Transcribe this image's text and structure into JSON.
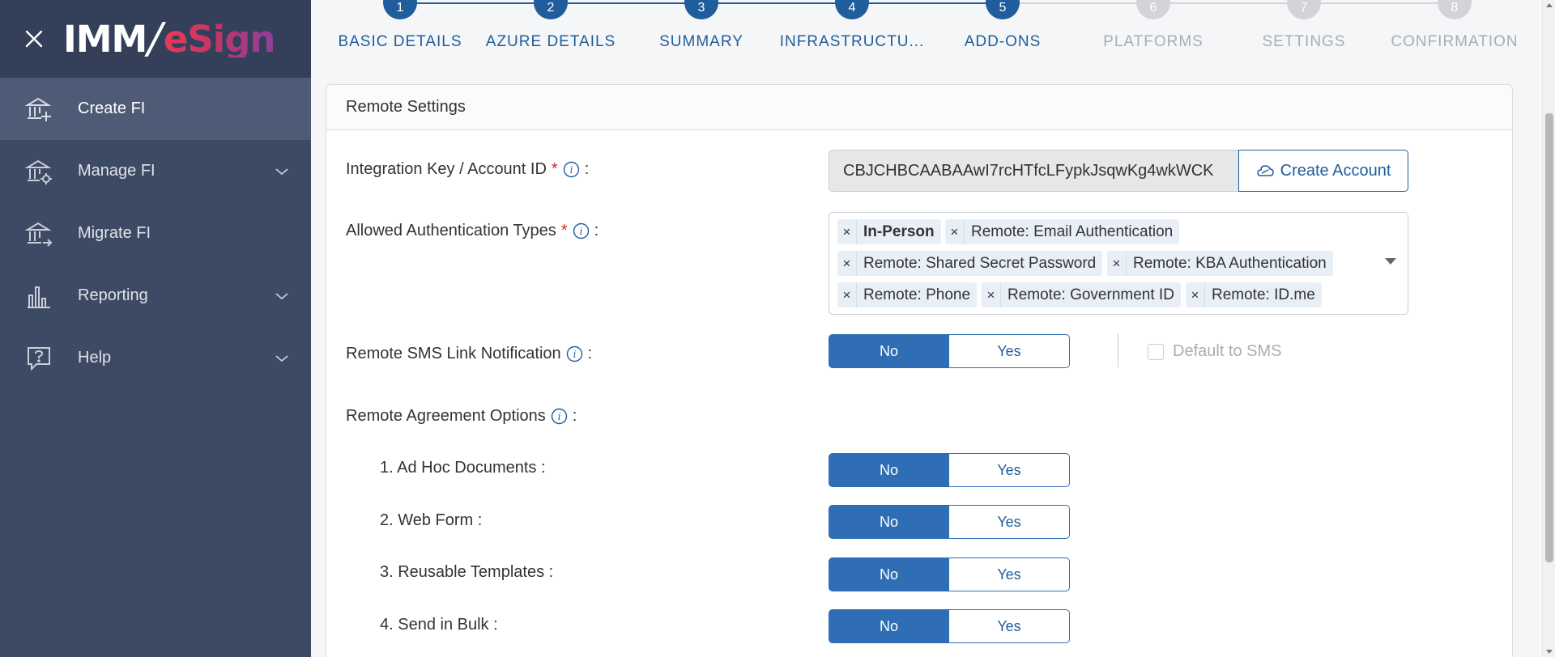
{
  "sidebar": {
    "close_icon": "close-icon",
    "logo": {
      "part1": "IMM",
      "slash": "/",
      "part2": "eSign"
    },
    "items": [
      {
        "label": "Create FI",
        "icon": "bank-add-icon",
        "active": true,
        "has_chevron": false
      },
      {
        "label": "Manage FI",
        "icon": "bank-gear-icon",
        "active": false,
        "has_chevron": true
      },
      {
        "label": "Migrate FI",
        "icon": "bank-arrow-icon",
        "active": false,
        "has_chevron": false
      },
      {
        "label": "Reporting",
        "icon": "bar-chart-icon",
        "active": false,
        "has_chevron": true
      },
      {
        "label": "Help",
        "icon": "help-bubble-icon",
        "active": false,
        "has_chevron": true
      }
    ]
  },
  "stepper": {
    "steps": [
      {
        "number": "1",
        "label": "BASIC DETAILS",
        "done": true
      },
      {
        "number": "2",
        "label": "AZURE DETAILS",
        "done": true
      },
      {
        "number": "3",
        "label": "SUMMARY",
        "done": true
      },
      {
        "number": "4",
        "label": "INFRASTRUCTU...",
        "done": true
      },
      {
        "number": "5",
        "label": "ADD-ONS",
        "done": true
      },
      {
        "number": "6",
        "label": "PLATFORMS",
        "done": false
      },
      {
        "number": "7",
        "label": "SETTINGS",
        "done": false
      },
      {
        "number": "8",
        "label": "CONFIRMATION",
        "done": false
      }
    ]
  },
  "card": {
    "title": "Remote Settings",
    "integration_key": {
      "label": "Integration Key / Account ID",
      "value": "CBJCHBCAABAAwI7rcHTfcLFypkJsqwKg4wkWCK",
      "create_account_label": "Create Account"
    },
    "auth_types": {
      "label": "Allowed Authentication Types",
      "tags": [
        {
          "text": "In-Person",
          "bold": true
        },
        {
          "text": "Remote: Email Authentication",
          "bold": false
        },
        {
          "text": "Remote: Shared Secret Password",
          "bold": false
        },
        {
          "text": "Remote: KBA Authentication",
          "bold": false
        },
        {
          "text": "Remote: Phone",
          "bold": false
        },
        {
          "text": "Remote: Government ID",
          "bold": false
        },
        {
          "text": "Remote: ID.me",
          "bold": false
        }
      ],
      "remove_glyph": "×"
    },
    "sms": {
      "label": "Remote SMS Link Notification",
      "no": "No",
      "yes": "Yes",
      "selected": "No",
      "default_label": "Default to SMS",
      "default_checked": false
    },
    "agreement": {
      "label": "Remote Agreement Options",
      "options": [
        {
          "label": "1. Ad Hoc Documents :",
          "no": "No",
          "yes": "Yes",
          "selected": "No"
        },
        {
          "label": "2. Web Form :",
          "no": "No",
          "yes": "Yes",
          "selected": "No"
        },
        {
          "label": "3. Reusable Templates :",
          "no": "No",
          "yes": "Yes",
          "selected": "No"
        },
        {
          "label": "4. Send in Bulk :",
          "no": "No",
          "yes": "Yes",
          "selected": "No"
        }
      ]
    }
  },
  "colors": {
    "sidebar_bg": "#3d4a63",
    "primary": "#1f5d9c",
    "toggle_on": "#2f6eb5",
    "required": "#d0282e",
    "muted": "#a9adb2"
  }
}
